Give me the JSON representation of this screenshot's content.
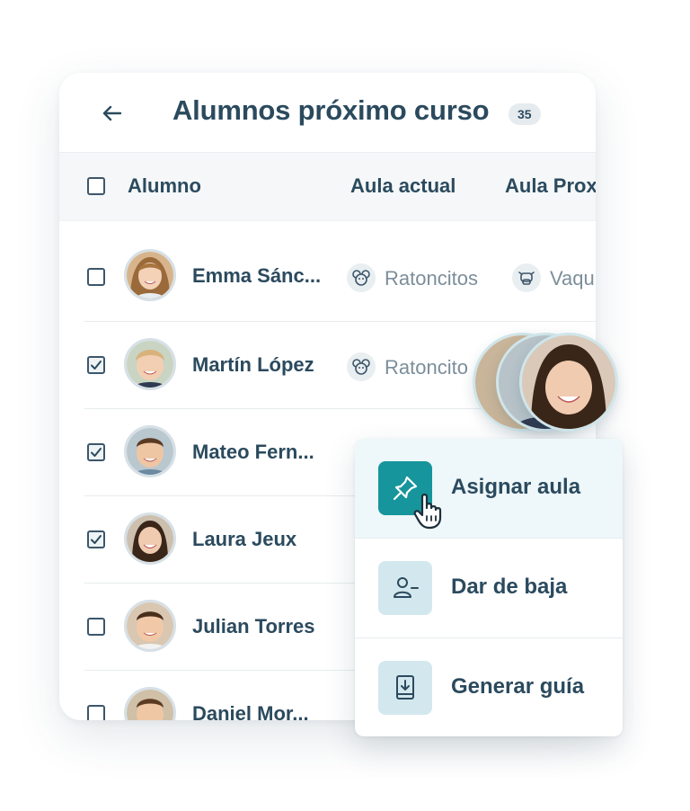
{
  "header": {
    "title": "Alumnos próximo curso",
    "count": "35",
    "back_icon": "arrow-left-icon"
  },
  "columns": [
    "Alumno",
    "Aula actual",
    "Aula Prox"
  ],
  "students": [
    {
      "name": "Emma Sánc...",
      "checked": false,
      "current_class": "Ratoncitos",
      "next_class": "Vaqu"
    },
    {
      "name": "Martín López",
      "checked": true,
      "current_class": "Ratoncito",
      "next_class": ""
    },
    {
      "name": "Mateo Fern...",
      "checked": true,
      "current_class": "",
      "next_class": ""
    },
    {
      "name": "Laura Jeux",
      "checked": true,
      "current_class": "",
      "next_class": ""
    },
    {
      "name": "Julian Torres",
      "checked": false,
      "current_class": "",
      "next_class": ""
    },
    {
      "name": "Daniel Mor...",
      "checked": false,
      "current_class": "",
      "next_class": ""
    }
  ],
  "context_menu": {
    "items": [
      {
        "label": "Asignar aula",
        "icon": "pin-icon",
        "selected": true
      },
      {
        "label": "Dar de baja",
        "icon": "user-remove-icon",
        "selected": false
      },
      {
        "label": "Generar guía",
        "icon": "book-download-icon",
        "selected": false
      }
    ]
  },
  "colors": {
    "text": "#2b4a5e",
    "accent": "#16959c",
    "muted": "#7c8e9a",
    "icon_bg": "#d3e8ee"
  }
}
